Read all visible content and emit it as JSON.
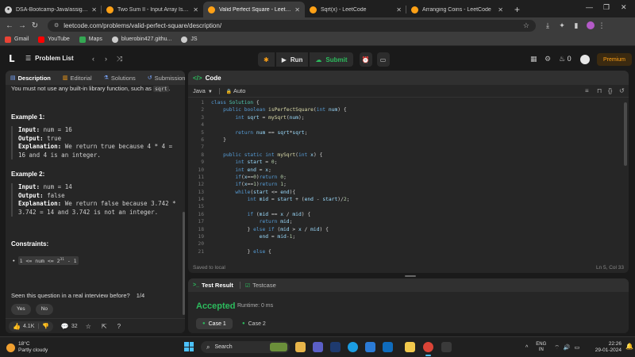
{
  "browser": {
    "tabs": [
      {
        "title": "DSA-Bootcamp-Java/assignme",
        "icon": "github-icon",
        "active": false
      },
      {
        "title": "Two Sum II - Input Array Is Sort",
        "icon": "leetcode-icon",
        "active": false
      },
      {
        "title": "Valid Perfect Square - LeetCode",
        "icon": "leetcode-icon",
        "active": true
      },
      {
        "title": "Sqrt(x) - LeetCode",
        "icon": "leetcode-icon",
        "active": false
      },
      {
        "title": "Arranging Coins - LeetCode",
        "icon": "leetcode-icon",
        "active": false
      }
    ],
    "new_tab": "+",
    "url": "leetcode.com/problems/valid-perfect-square/description/",
    "bookmarks": [
      {
        "label": "Gmail",
        "color": "#ea4335"
      },
      {
        "label": "YouTube",
        "color": "#ff0000"
      },
      {
        "label": "Maps",
        "color": "#34a853"
      },
      {
        "label": "bluerobin427.githu...",
        "color": "#cccccc"
      },
      {
        "label": "JS",
        "color": "#cccccc"
      }
    ]
  },
  "header": {
    "problem_list": "Problem List",
    "run": "Run",
    "submit": "Submit",
    "streak": "0",
    "premium": "Premium",
    "accent": "#ffa116",
    "green": "#2cbb5d"
  },
  "left": {
    "tabs": [
      "Description",
      "Editorial",
      "Solutions",
      "Submissions"
    ],
    "intro_text": "You must not use any built-in library function, such as ",
    "intro_code": "sqrt",
    "intro_end": ".",
    "example1": {
      "heading": "Example 1:",
      "input_label": "Input:",
      "input": " num = 16",
      "output_label": "Output:",
      "output": " true",
      "expl_label": "Explanation:",
      "expl": " We return true because 4 * 4 = 16 and 4 is an integer."
    },
    "example2": {
      "heading": "Example 2:",
      "input_label": "Input:",
      "input": " num = 14",
      "output_label": "Output:",
      "output": " false",
      "expl_label": "Explanation:",
      "expl": " We return false because 3.742 * 3.742 = 14 and 3.742 is not an integer."
    },
    "constraints_heading": "Constraints:",
    "constraint_before": "1 <= num <= 2",
    "constraint_sup": "31",
    "constraint_after": " - 1",
    "interview_q": "Seen this question in a real interview before?",
    "interview_page": "1/4",
    "yes": "Yes",
    "no": "No",
    "likes": "4.1K",
    "comments": "32"
  },
  "code": {
    "title": "Code",
    "language": "Java",
    "auto": "Auto",
    "saved": "Saved to local",
    "cursor": "Ln 5, Col 33"
  },
  "result": {
    "tabs": [
      "Test Result",
      "Testcase"
    ],
    "status": "Accepted",
    "runtime": "Runtime: 0 ms",
    "cases": [
      "Case 1",
      "Case 2"
    ]
  },
  "taskbar": {
    "temp": "18°C",
    "weather": "Partly cloudy",
    "search": "Search",
    "lang1": "ENG",
    "lang2": "IN",
    "time": "22:26",
    "date": "29-01-2024"
  }
}
